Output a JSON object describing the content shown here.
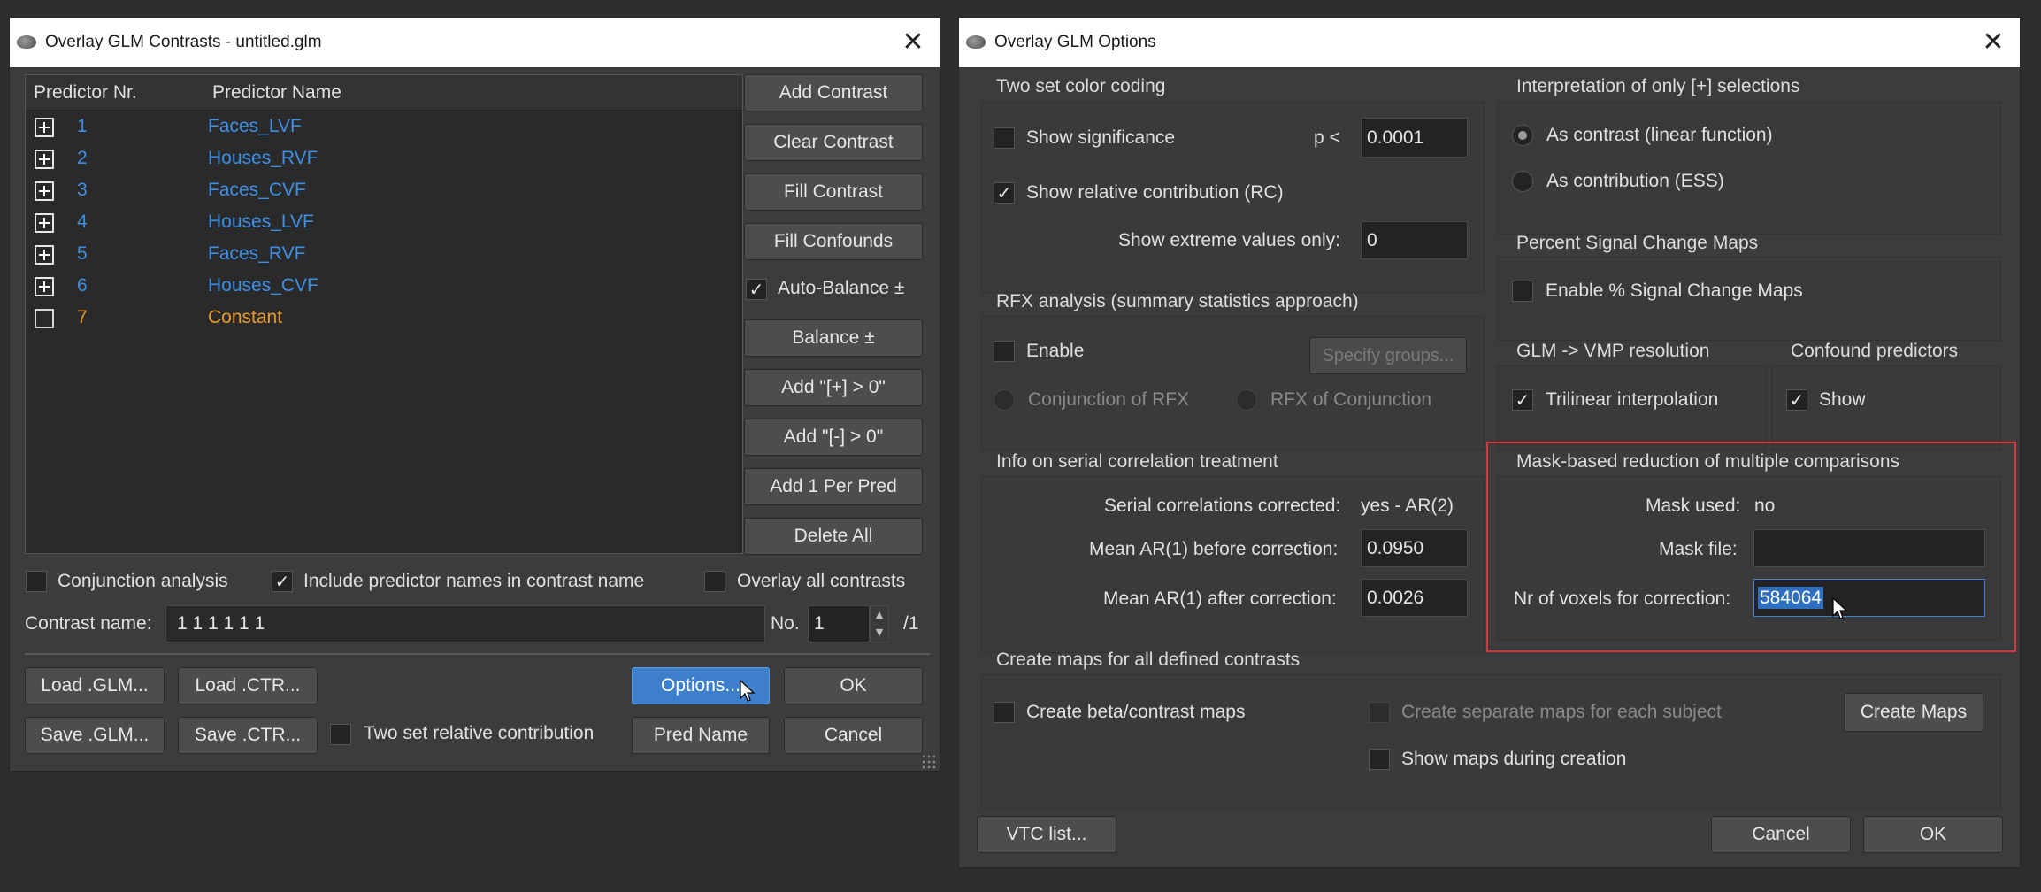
{
  "contrasts_window": {
    "title": "Overlay GLM Contrasts - untitled.glm",
    "table": {
      "col_nr": "Predictor Nr.",
      "col_name": "Predictor Name",
      "rows": [
        {
          "nr": "1",
          "name": "Faces_LVF"
        },
        {
          "nr": "2",
          "name": "Houses_RVF"
        },
        {
          "nr": "3",
          "name": "Faces_CVF"
        },
        {
          "nr": "4",
          "name": "Houses_LVF"
        },
        {
          "nr": "5",
          "name": "Faces_RVF"
        },
        {
          "nr": "6",
          "name": "Houses_CVF"
        },
        {
          "nr": "7",
          "name": "Constant"
        }
      ]
    },
    "buttons": {
      "add_contrast": "Add Contrast",
      "clear_contrast": "Clear Contrast",
      "fill_contrast": "Fill Contrast",
      "fill_confounds": "Fill Confounds",
      "balance": "Balance ±",
      "add_plus": "Add \"[+] > 0\"",
      "add_minus": "Add \"[-]  > 0\"",
      "add_per_pred": "Add 1 Per Pred",
      "delete_all": "Delete All",
      "load_glm": "Load .GLM...",
      "load_ctr": "Load .CTR...",
      "save_glm": "Save .GLM...",
      "save_ctr": "Save .CTR...",
      "options": "Options...",
      "ok": "OK",
      "pred_name": "Pred  Name",
      "cancel": "Cancel"
    },
    "auto_balance": "Auto-Balance ±",
    "conjunction": "Conjunction analysis",
    "include_names": "Include predictor names in contrast name",
    "overlay_all": "Overlay all contrasts",
    "contrast_name_label": "Contrast name:",
    "contrast_name_value": "1  1  1  1  1  1",
    "no_label": "No.",
    "no_value": "1",
    "no_total": "/1",
    "two_set_rc": "Two set relative contribution"
  },
  "options_window": {
    "title": "Overlay GLM Options",
    "two_set": {
      "header": "Two set color coding",
      "show_significance": "Show significance",
      "p_label": "p <",
      "p_value": "0.0001",
      "show_rc": "Show relative contribution (RC)",
      "extreme_label": "Show extreme values only:",
      "extreme_value": "0"
    },
    "interpretation": {
      "header": "Interpretation of only [+] selections",
      "as_contrast": "As contrast (linear function)",
      "as_contribution": "As contribution (ESS)"
    },
    "psc": {
      "header": "Percent Signal Change Maps",
      "enable": "Enable % Signal Change Maps"
    },
    "rfx": {
      "header": "RFX analysis (summary statistics approach)",
      "enable": "Enable",
      "specify": "Specify groups...",
      "conj_rfx": "Conjunction of RFX",
      "rfx_conj": "RFX of Conjunction"
    },
    "vmp": {
      "header": "GLM -> VMP resolution",
      "trilinear": "Trilinear interpolation"
    },
    "confound": {
      "header": "Confound predictors",
      "show": "Show"
    },
    "serial": {
      "header": "Info on serial correlation treatment",
      "corrected_label": "Serial correlations corrected:",
      "corrected_value": "yes - AR(2)",
      "before_label": "Mean AR(1) before correction:",
      "before_value": "0.0950",
      "after_label": "Mean AR(1) after correction:",
      "after_value": "0.0026"
    },
    "mask": {
      "header": "Mask-based reduction of multiple comparisons",
      "used_label": "Mask used:",
      "used_value": "no",
      "file_label": "Mask file:",
      "file_value": "",
      "voxels_label": "Nr of voxels for correction:",
      "voxels_value": "584064"
    },
    "maps": {
      "header": "Create maps for all defined contrasts",
      "beta": "Create beta/contrast maps",
      "separate": "Create separate maps for each subject",
      "show_during": "Show maps during creation",
      "create": "Create Maps"
    },
    "vtc_list": "VTC list...",
    "cancel": "Cancel",
    "ok": "OK"
  },
  "colors": {
    "predictor_blue": "#3d8fe6",
    "constant_orange": "#e89a2f",
    "highlight_red": "#d9363e",
    "selection_blue": "#2f6fc0"
  },
  "icons": {
    "close": "close-icon",
    "expand": "plus-box-icon",
    "mouse": "mouse-cursor-icon"
  }
}
